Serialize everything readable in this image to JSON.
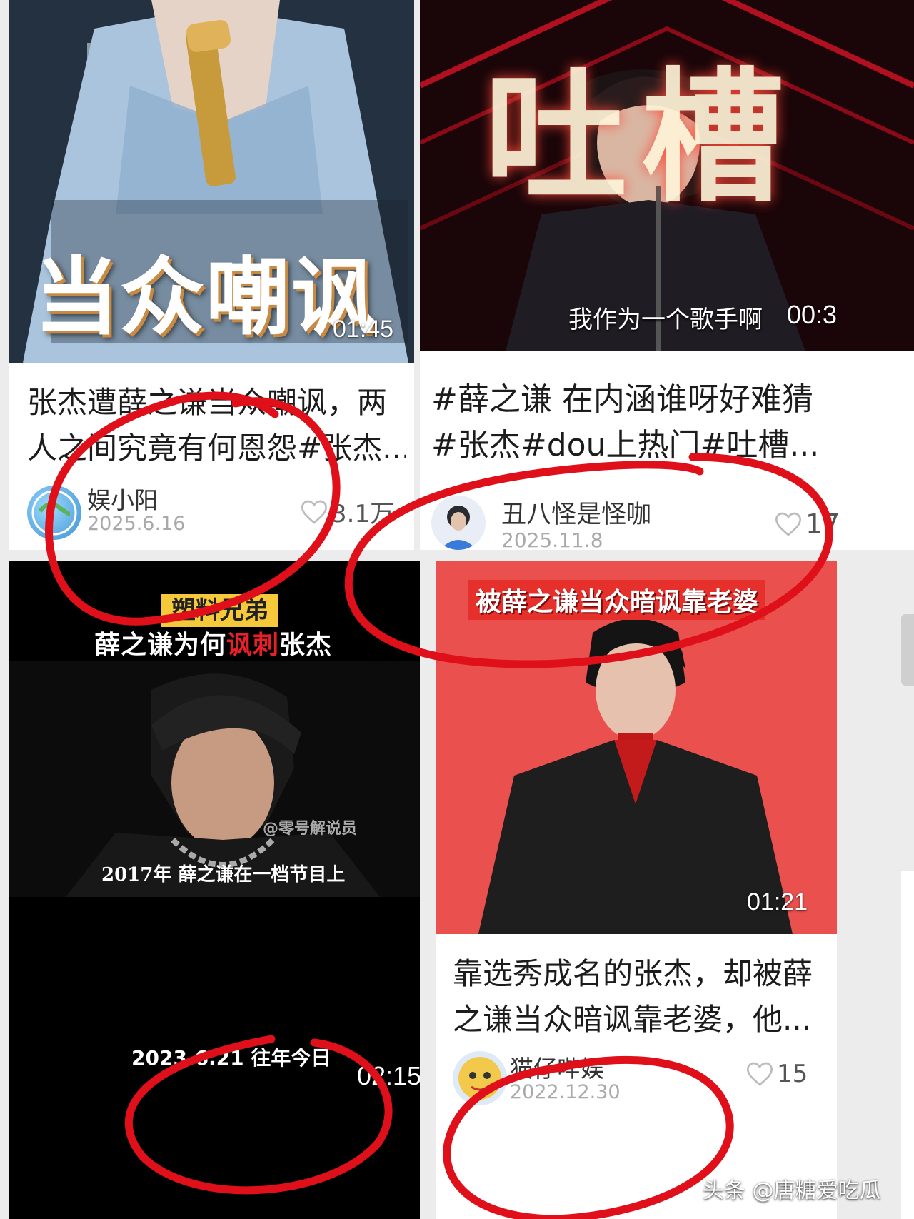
{
  "cards": [
    {
      "thumb_overlay": "当众嘲讽",
      "duration": "01:45",
      "title_line1": "张杰遭薛之谦当众嘲讽，两",
      "title_line2": "人之间究竟有何恩怨#张杰...",
      "author": "娱小阳",
      "date": "2025.6.16",
      "likes": "3.1万"
    },
    {
      "thumb_overlay": "吐槽",
      "thumb_subtitle": "我作为一个歌手啊",
      "duration": "00:3",
      "title_line1": "#薛之谦 在内涵谁呀好难猜",
      "title_line2": "#张杰#dou上热门#吐槽...",
      "author": "丑八怪是怪咖",
      "date": "2025.11.8",
      "likes": "17"
    },
    {
      "thumb_badge": "塑料兄弟",
      "thumb_headline_a": "薛之谦为何",
      "thumb_headline_b": "讽刺",
      "thumb_headline_c": "张杰",
      "thumb_watermark": "@零号解说员",
      "thumb_subtitle": "2017年 薛之谦在一档节目上",
      "memory_label": "2023.6.21 往年今日",
      "duration": "02:15"
    },
    {
      "thumb_banner": "被薛之谦当众暗讽靠老婆",
      "duration": "01:21",
      "title_line1": "靠选秀成名的张杰，却被薛",
      "title_line2": "之谦当众暗讽靠老婆，他...",
      "author": "猫仔哔娱",
      "date": "2022.12.30",
      "likes": "15"
    }
  ],
  "footer": {
    "platform": "头条",
    "handle": "@唐糖爱吃瓜"
  },
  "colors": {
    "annotation": "#e0101a",
    "card_bg": "#ffffff",
    "page_bg": "#ececec",
    "date": "#a9a9a9"
  }
}
